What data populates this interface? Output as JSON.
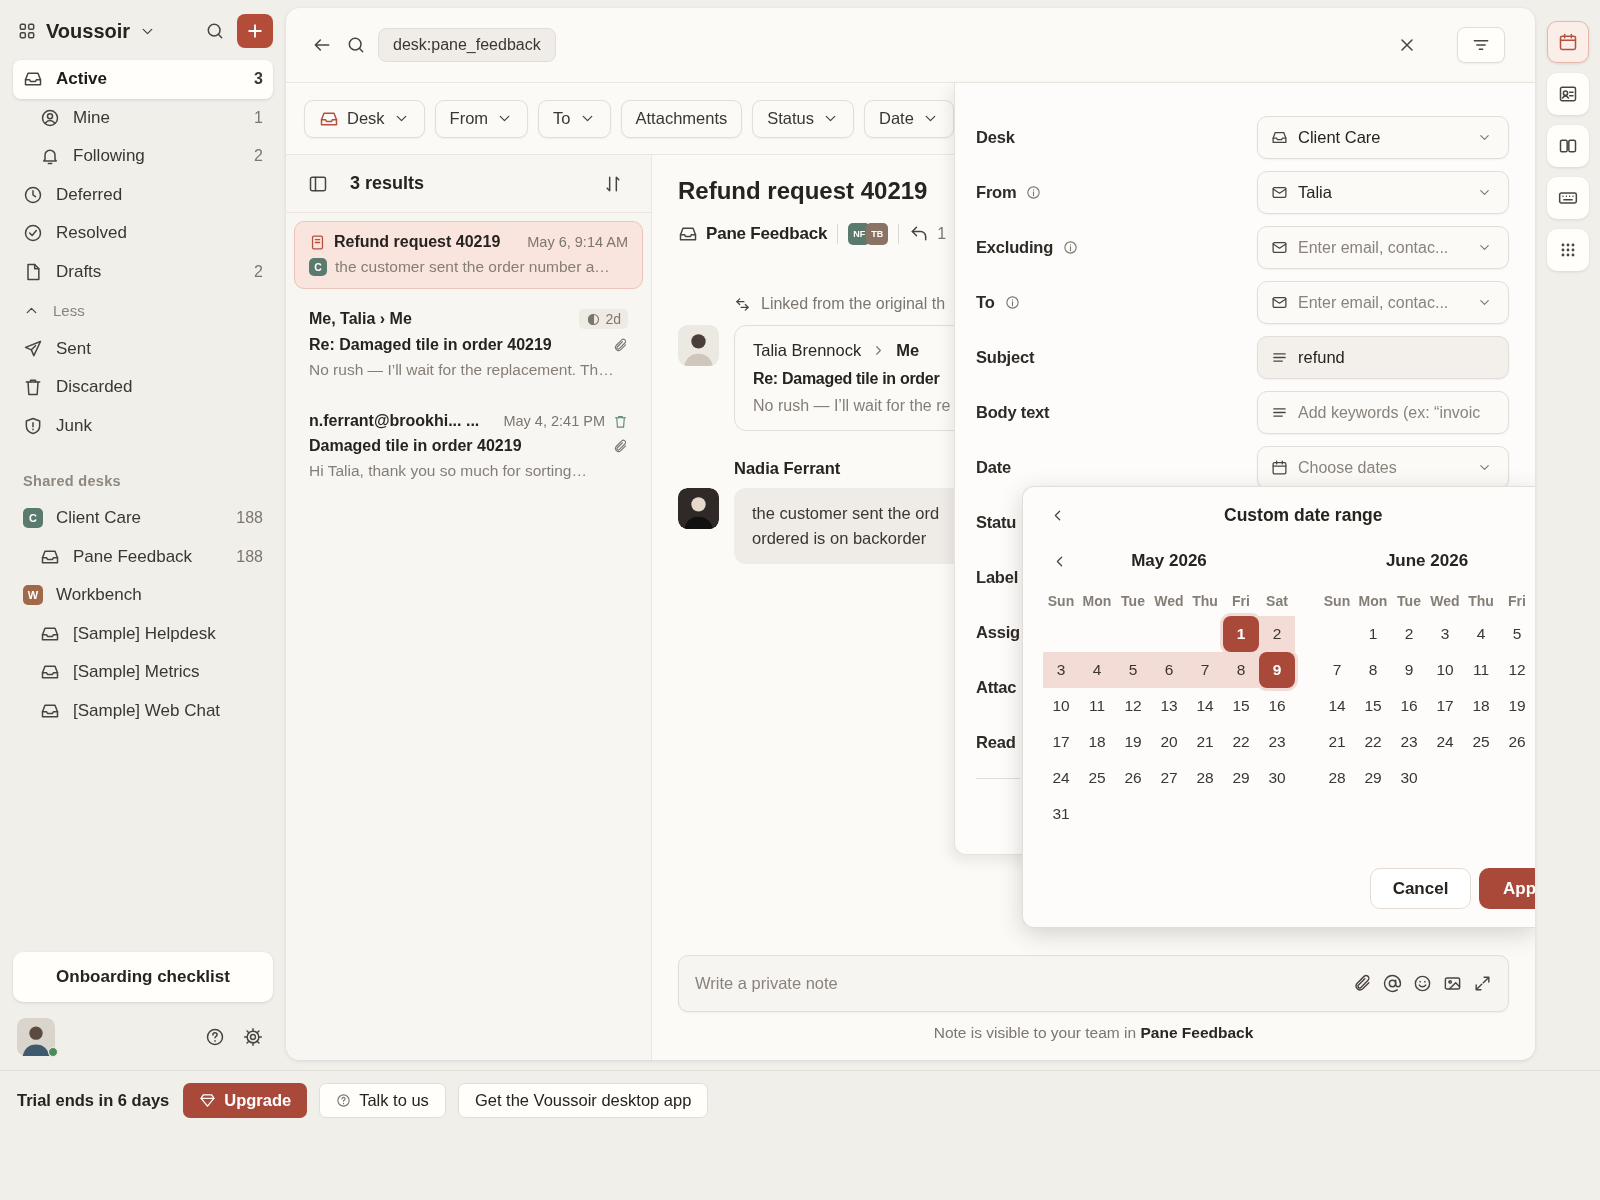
{
  "workspace": {
    "name": "Voussoir"
  },
  "nav": [
    {
      "label": "Active",
      "count": "3",
      "selected": true,
      "children": [
        {
          "label": "Mine",
          "count": "1",
          "selected": false
        },
        {
          "label": "Following",
          "count": "2",
          "selected": false
        }
      ]
    },
    {
      "label": "Deferred",
      "selected": false
    },
    {
      "label": "Resolved",
      "selected": false
    },
    {
      "label": "Drafts",
      "count": "2",
      "selected": false
    }
  ],
  "less_toggle": {
    "label": "Less",
    "expanded": true
  },
  "more_nav": [
    {
      "label": "Sent",
      "selected": false
    },
    {
      "label": "Discarded",
      "selected": false
    },
    {
      "label": "Junk",
      "selected": false
    }
  ],
  "shared_desks": {
    "heading": "Shared desks",
    "desks": [
      {
        "badge": "C",
        "label": "Client Care",
        "count": "188",
        "color": "#5b7a6e",
        "children": [
          {
            "label": "Pane Feedback",
            "count": "188"
          }
        ]
      },
      {
        "badge": "W",
        "label": "Workbench",
        "color": "#a0694a",
        "children": [
          {
            "label": "[Sample] Helpdesk"
          },
          {
            "label": "[Sample] Metrics"
          },
          {
            "label": "[Sample] Web Chat"
          }
        ]
      }
    ]
  },
  "onboarding_button": "Onboarding checklist",
  "user": {
    "online": true
  },
  "search": {
    "query": "desk:pane_feedback"
  },
  "filter_chips": [
    {
      "label": "Desk",
      "dropdown": true,
      "active": true
    },
    {
      "label": "From",
      "dropdown": true,
      "active": false
    },
    {
      "label": "To",
      "dropdown": true,
      "active": false
    },
    {
      "label": "Attachments",
      "dropdown": false,
      "active": false
    },
    {
      "label": "Status",
      "dropdown": true,
      "active": false
    },
    {
      "label": "Date",
      "dropdown": true,
      "active": false
    }
  ],
  "results": {
    "count_label": "3 results",
    "items": [
      {
        "kind": "draft",
        "title": "Refund request 40219",
        "time": "May 6, 9:14 AM",
        "badge": "C",
        "snippet": "the customer sent the order number a…",
        "selected": true
      },
      {
        "kind": "reply",
        "from": "Me, Talia › Me",
        "age": "2d",
        "subject": "Re: Damaged tile in order 40219",
        "snippet": "No rush — I’ll wait for the replacement. Th…",
        "attachment": true,
        "selected": false
      },
      {
        "kind": "email",
        "from": "n.ferrant@brookhi... ...",
        "time": "May 4, 2:41 PM",
        "subject": "Damaged tile in order 40219",
        "snippet": "Hi Talia, thank you so much for sorting…",
        "attachment": true,
        "selected": false
      }
    ]
  },
  "conversation": {
    "title": "Refund request 40219",
    "desk": "Pane Feedback",
    "participants": [
      {
        "initials": "NF",
        "color": "#5b7a6e"
      },
      {
        "initials": "TB",
        "color": "#8a7264"
      }
    ],
    "reply_count": "1",
    "linked_note": "Linked from the original th",
    "messages": [
      {
        "kind": "card",
        "sender": "Talia Brennock",
        "recipient": "Me",
        "subject": "Re: Damaged tile in order",
        "lines": [
          "No rush — I’ll wait for the re"
        ]
      },
      {
        "kind": "bubble",
        "sender": "Nadia Ferrant",
        "lines": [
          "the customer sent the ord",
          "ordered is on backorder"
        ]
      }
    ]
  },
  "composer": {
    "placeholder": "Write a private note",
    "hint": "Note is visible to your team in **Pane Feedback**"
  },
  "filter_panel": {
    "fields": [
      {
        "label": "Desk",
        "info": false,
        "kind": "desk",
        "value": "Client Care"
      },
      {
        "label": "From",
        "info": true,
        "kind": "contact",
        "value": "Talia"
      },
      {
        "label": "Excluding",
        "info": true,
        "kind": "contact",
        "placeholder": "Enter email, contac..."
      },
      {
        "label": "To",
        "info": true,
        "kind": "contact",
        "placeholder": "Enter email, contac..."
      },
      {
        "label": "Subject",
        "info": false,
        "kind": "text",
        "value": "refund"
      },
      {
        "label": "Body text",
        "info": false,
        "kind": "text",
        "placeholder": "Add keywords (ex: “invoic"
      },
      {
        "label": "Date",
        "info": false,
        "kind": "date",
        "placeholder": "Choose dates"
      }
    ],
    "hidden_labels": [
      "Statu",
      "Label",
      "Assig",
      "Attac",
      "Read"
    ]
  },
  "date_picker": {
    "title": "Custom date range",
    "months": [
      {
        "label": "May 2026",
        "weekdays": [
          "Sun",
          "Mon",
          "Tue",
          "Wed",
          "Thu",
          "Fri",
          "Sat"
        ],
        "weeks": [
          [
            {
              "day": "1",
              "selected": true,
              "endpoint": true
            },
            {
              "day": "2",
              "selected": true,
              "endpoint": false
            }
          ],
          [
            {
              "day": "3",
              "selected": true,
              "endpoint": false
            },
            {
              "day": "4",
              "selected": true,
              "endpoint": false
            },
            {
              "day": "5",
              "selected": true,
              "endpoint": false
            },
            {
              "day": "6",
              "selected": true,
              "endpoint": false
            },
            {
              "day": "7",
              "selected": true,
              "endpoint": false
            },
            {
              "day": "8",
              "selected": true,
              "endpoint": false
            },
            {
              "day": "9",
              "selected": true,
              "endpoint": true
            }
          ],
          [
            {
              "day": "10",
              "selected": false,
              "endpoint": false
            },
            {
              "day": "11",
              "selected": false,
              "endpoint": false
            },
            {
              "day": "12",
              "selected": false,
              "endpoint": false
            },
            {
              "day": "13",
              "selected": false,
              "endpoint": false
            },
            {
              "day": "14",
              "selected": false,
              "endpoint": false
            },
            {
              "day": "15",
              "selected": false,
              "endpoint": false
            },
            {
              "day": "16",
              "selected": false,
              "endpoint": false
            }
          ],
          [
            {
              "day": "17",
              "selected": false,
              "endpoint": false
            },
            {
              "day": "18",
              "selected": false,
              "endpoint": false
            },
            {
              "day": "19",
              "selected": false,
              "endpoint": false
            },
            {
              "day": "20",
              "selected": false,
              "endpoint": false
            },
            {
              "day": "21",
              "selected": false,
              "endpoint": false
            },
            {
              "day": "22",
              "selected": false,
              "endpoint": false
            },
            {
              "day": "23",
              "selected": false,
              "endpoint": false
            }
          ],
          [
            {
              "day": "24",
              "selected": false,
              "endpoint": false
            },
            {
              "day": "25",
              "selected": false,
              "endpoint": false
            },
            {
              "day": "26",
              "selected": false,
              "endpoint": false
            },
            {
              "day": "27",
              "selected": false,
              "endpoint": false
            },
            {
              "day": "28",
              "selected": false,
              "endpoint": false
            },
            {
              "day": "29",
              "selected": false,
              "endpoint": false
            },
            {
              "day": "30",
              "selected": false,
              "endpoint": false
            }
          ],
          [
            {
              "day": "31",
              "selected": false,
              "endpoint": false
            }
          ]
        ]
      },
      {
        "label": "June 2026",
        "weekdays": [
          "Sun",
          "Mon",
          "Tue",
          "Wed",
          "Thu",
          "Fri"
        ],
        "weeks": [
          [
            {
              "day": "1",
              "selected": false,
              "endpoint": false
            },
            {
              "day": "2",
              "selected": false,
              "endpoint": false
            },
            {
              "day": "3",
              "selected": false,
              "endpoint": false
            },
            {
              "day": "4",
              "selected": false,
              "endpoint": false
            },
            {
              "day": "5",
              "selected": false,
              "endpoint": false
            }
          ],
          [
            {
              "day": "7",
              "selected": false,
              "endpoint": false
            },
            {
              "day": "8",
              "selected": false,
              "endpoint": false
            },
            {
              "day": "9",
              "selected": false,
              "endpoint": false
            },
            {
              "day": "10",
              "selected": false,
              "endpoint": false
            },
            {
              "day": "11",
              "selected": false,
              "endpoint": false
            },
            {
              "day": "12",
              "selected": false,
              "endpoint": false
            }
          ],
          [
            {
              "day": "14",
              "selected": false,
              "endpoint": false
            },
            {
              "day": "15",
              "selected": false,
              "endpoint": false
            },
            {
              "day": "16",
              "selected": false,
              "endpoint": false
            },
            {
              "day": "17",
              "selected": false,
              "endpoint": false
            },
            {
              "day": "18",
              "selected": false,
              "endpoint": false
            },
            {
              "day": "19",
              "selected": false,
              "endpoint": false
            }
          ],
          [
            {
              "day": "21",
              "selected": false,
              "endpoint": false
            },
            {
              "day": "22",
              "selected": false,
              "endpoint": false
            },
            {
              "day": "23",
              "selected": false,
              "endpoint": false
            },
            {
              "day": "24",
              "selected": false,
              "endpoint": false
            },
            {
              "day": "25",
              "selected": false,
              "endpoint": false
            },
            {
              "day": "26",
              "selected": false,
              "endpoint": false
            }
          ],
          [
            {
              "day": "28",
              "selected": false,
              "endpoint": false
            },
            {
              "day": "29",
              "selected": false,
              "endpoint": false
            },
            {
              "day": "30",
              "selected": false,
              "endpoint": false
            }
          ]
        ]
      }
    ],
    "buttons": [
      {
        "label": "Cancel",
        "kind": "secondary"
      },
      {
        "label": "App",
        "kind": "primary"
      }
    ]
  },
  "rail": [
    {
      "selected": true
    },
    {
      "selected": false
    },
    {
      "selected": false
    },
    {
      "selected": false
    },
    {
      "selected": false
    }
  ],
  "trial_bar": {
    "text": "Trial ends in 6 days",
    "upgrade": "Upgrade",
    "talk": "Talk to us",
    "desktop": "Get the Voussoir desktop app"
  }
}
